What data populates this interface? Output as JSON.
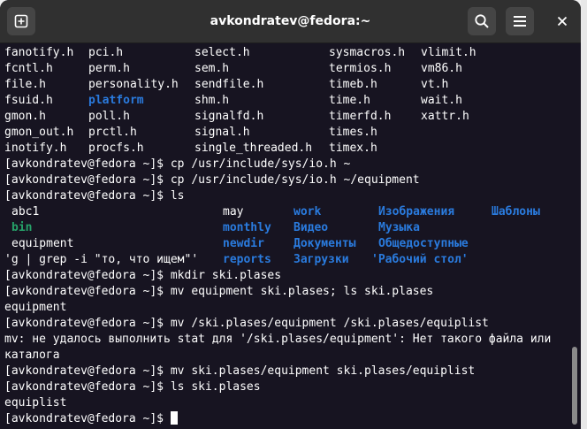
{
  "window": {
    "title": "avkondratev@fedora:~"
  },
  "terminal": {
    "file_rows": [
      [
        "fanotify.h",
        "pci.h",
        "select.h",
        "sysmacros.h",
        "vlimit.h"
      ],
      [
        "fcntl.h",
        "perm.h",
        "sem.h",
        "termios.h",
        "vm86.h"
      ],
      [
        "file.h",
        "personality.h",
        "sendfile.h",
        "timeb.h",
        "vt.h"
      ],
      [
        "fsuid.h",
        "platform",
        "shm.h",
        "time.h",
        "wait.h"
      ],
      [
        "gmon.h",
        "poll.h",
        "signalfd.h",
        "timerfd.h",
        "xattr.h"
      ],
      [
        "gmon_out.h",
        "prctl.h",
        "signal.h",
        "times.h",
        ""
      ],
      [
        "inotify.h",
        "procfs.h",
        "single_threaded.h",
        "timex.h",
        ""
      ]
    ],
    "prompt": "[avkondratev@fedora ~]$ ",
    "commands": {
      "cp1": "cp /usr/include/sys/io.h ~",
      "cp2": "cp /usr/include/sys/io.h ~/equipment",
      "ls": "ls",
      "mkdir": "mkdir ski.plases",
      "mv1": "mv equipment ski.plases; ls ski.plases",
      "mv2": "mv /ski.plases/equipment /ski.plases/equiplist",
      "mv3": "mv ski.plases/equipment ski.plases/equiplist",
      "ls2": "ls ski.plases"
    },
    "ls_rows": [
      [
        "abc1",
        "may",
        "work",
        "Изображения",
        "Шаблоны"
      ],
      [
        "bin",
        "monthly",
        "Видео",
        "Музыка",
        ""
      ],
      [
        "equipment",
        "newdir",
        "Документы",
        "Общедоступные",
        ""
      ],
      [
        "'g | grep -i \"то, что ищем\"'",
        "reports",
        "Загрузки",
        "'Рабочий стол'",
        ""
      ]
    ],
    "outputs": {
      "mv1_out": "equipment",
      "mv2_err_1": "mv: не удалось выполнить stat для '/ski.plases/equipment': Нет такого файла или",
      "mv2_err_2": "каталога",
      "ls2_out": "equiplist"
    }
  },
  "colors": {
    "terminal_bg": "#171421",
    "titlebar_bg": "#303030",
    "directory": "#2a7bde",
    "exec_dir": "#26a269",
    "text": "#ffffff"
  },
  "icons": {
    "new_tab": "new-tab-icon",
    "search": "search-icon",
    "menu": "hamburger-menu-icon",
    "close": "close-icon"
  }
}
